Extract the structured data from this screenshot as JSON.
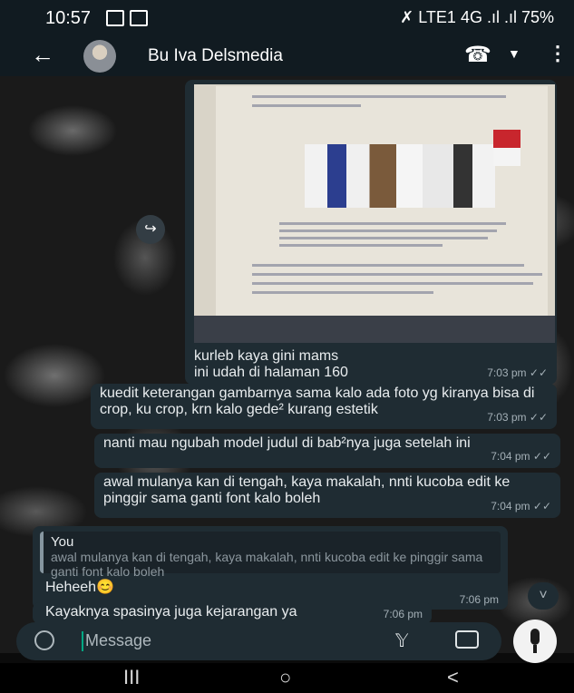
{
  "status": {
    "time": "10:57",
    "right": "✗ LTE1 4G .ıl .ıl 75%"
  },
  "header": {
    "contact": "Bu Iva Delsmedia",
    "back_glyph": "←",
    "call_glyph": "☎",
    "caret_glyph": "▼",
    "more_glyph": "⋮"
  },
  "messages": [
    {
      "text": "kurleb kaya gini mams\nini udah di halaman 160",
      "time": "7:03 pm",
      "ticks": "✓✓"
    },
    {
      "text": "kuedit keterangan gambarnya sama kalo ada foto yg kiranya bisa di crop, ku crop, krn kalo gede² kurang estetik",
      "time": "7:03 pm",
      "ticks": "✓✓"
    },
    {
      "text": "nanti mau ngubah model judul di bab²nya juga setelah ini",
      "time": "7:04 pm",
      "ticks": "✓✓"
    },
    {
      "text": "awal mulanya kan di tengah, kaya makalah, nnti kucoba edit ke pinggir sama ganti font kalo boleh",
      "time": "7:04 pm",
      "ticks": "✓✓"
    }
  ],
  "reply": {
    "quote_author": "You",
    "quote_text": "awal mulanya kan di tengah, kaya makalah, nnti kucoba edit ke pinggir sama ganti font kalo boleh",
    "text": "Heheeh😊",
    "time": "7:06 pm"
  },
  "incoming_last": {
    "text": "Kayaknya spasinya juga kejarangan ya",
    "time": "7:06 pm"
  },
  "forward_glyph": "↪",
  "scroll_glyph": "˅",
  "composer": {
    "placeholder": "Message"
  },
  "nav": {
    "recents": "III",
    "home": "○",
    "back": "<"
  },
  "colors": {
    "bubble": "#1f2c33",
    "accent": "#00a884",
    "header": "#111b21"
  }
}
